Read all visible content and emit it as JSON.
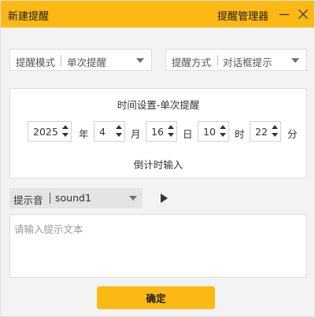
{
  "window": {
    "title": "新建提醒",
    "manager_label": "提醒管理器"
  },
  "mode_select": {
    "label": "提醒模式",
    "value": "单次提醒"
  },
  "method_select": {
    "label": "提醒方式",
    "value": "对话框提示"
  },
  "time_settings": {
    "title": "时间设置-单次提醒",
    "year": {
      "value": "2025",
      "unit": "年"
    },
    "month": {
      "value": "4",
      "unit": "月"
    },
    "day": {
      "value": "16",
      "unit": "日"
    },
    "hour": {
      "value": "10",
      "unit": "时"
    },
    "minute": {
      "value": "22",
      "unit": "分"
    },
    "countdown_label": "倒计时输入"
  },
  "sound": {
    "label": "提示音",
    "value": "sound1"
  },
  "text_input": {
    "placeholder": "请输入提示文本",
    "value": ""
  },
  "confirm_label": "确定",
  "colors": {
    "accent": "#fdb913",
    "background": "#f3f3f3"
  },
  "icons": {
    "minimize": "minimize-icon",
    "close": "close-icon",
    "play": "play-icon"
  }
}
